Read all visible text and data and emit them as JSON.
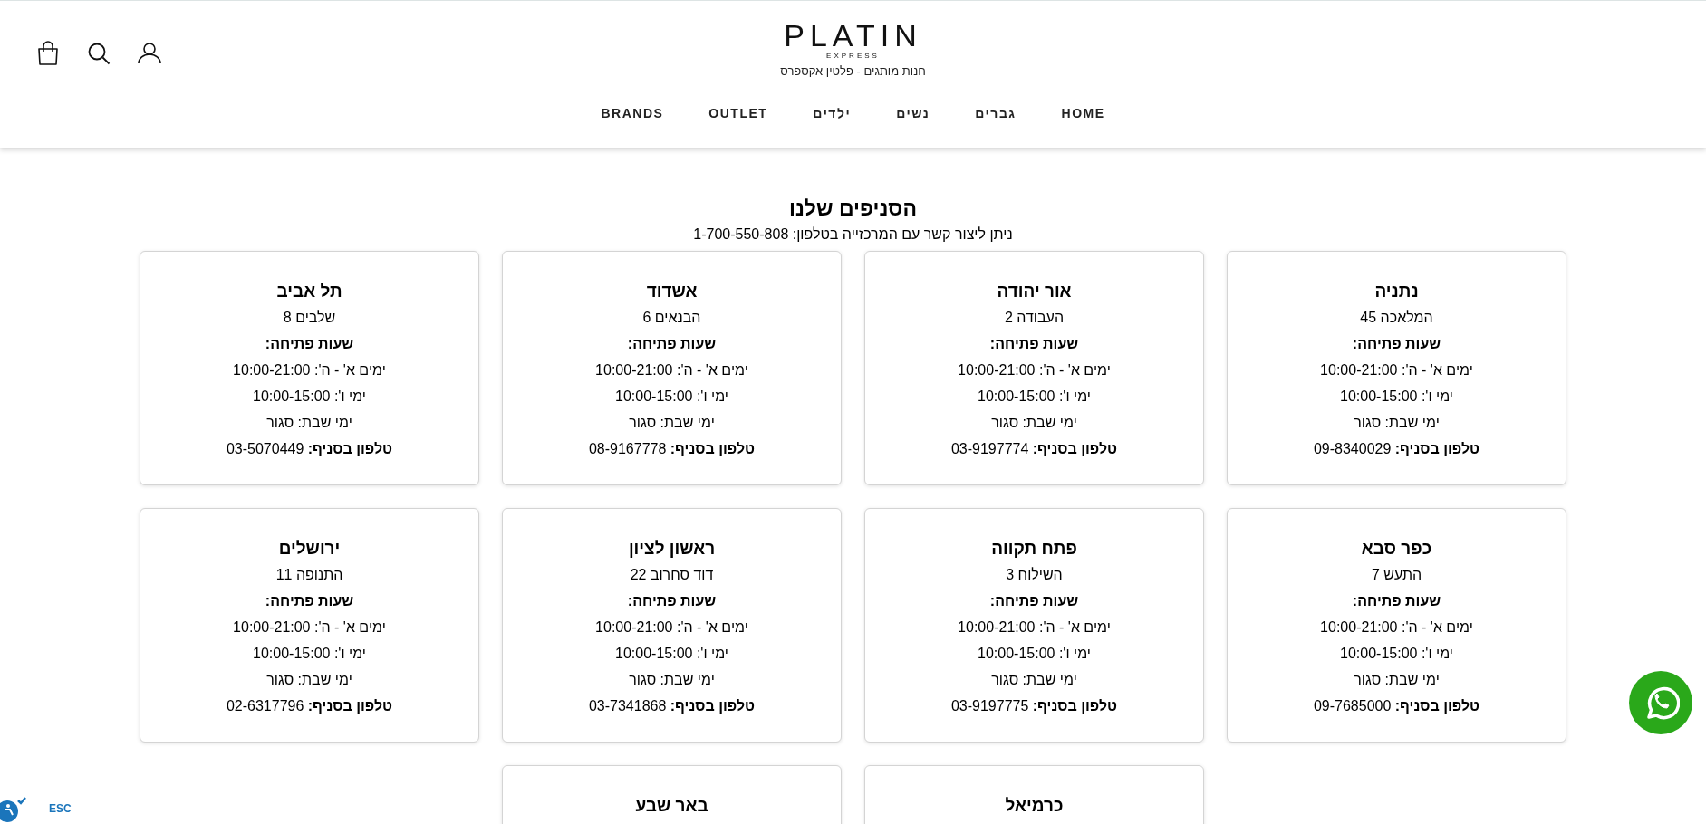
{
  "header": {
    "logo": "PLATIN",
    "logo_sub": "EXPRESS",
    "tagline": "חנות מותגים - פלטין אקספרס",
    "nav": [
      {
        "label": "HOME"
      },
      {
        "label": "גברים"
      },
      {
        "label": "נשים"
      },
      {
        "label": "ילדים"
      },
      {
        "label": "OUTLET"
      },
      {
        "label": "BRANDS"
      }
    ]
  },
  "page": {
    "title": "הסניפים שלנו",
    "subtitle": "ניתן ליצור קשר עם המרכזייה בטלפון: 1-700-550-808"
  },
  "branches": [
    {
      "name": "נתניה",
      "address": "המלאכה 45",
      "hours_title": "שעות פתיחה:",
      "lines": [
        "ימים א' - ה': 10:00-21:00",
        "ימי ו': 10:00-15:00",
        "ימי שבת: סגור"
      ],
      "phone": "**טלפון בסניף:** 09-8340029"
    },
    {
      "name": "אור יהודה",
      "address": "העבודה 2",
      "hours_title": "שעות פתיחה:",
      "lines": [
        "ימים א' - ה': 10:00-21:00",
        "ימי ו': 10:00-15:00",
        "ימי שבת: סגור"
      ],
      "phone": "**טלפון בסניף:** 03-9197774"
    },
    {
      "name": "אשדוד",
      "address": "הבנאים 6",
      "hours_title": "שעות פתיחה:",
      "lines": [
        "ימים א' - ה': 10:00-21:00",
        "ימי ו': 10:00-15:00",
        "ימי שבת: סגור"
      ],
      "phone": "**טלפון בסניף:** 08-9167778"
    },
    {
      "name": "תל אביב",
      "address": "שלבים 8",
      "hours_title": "שעות פתיחה:",
      "lines": [
        "ימים א' - ה': 10:00-21:00",
        "ימי ו': 10:00-15:00",
        "ימי שבת: סגור"
      ],
      "phone": "**טלפון בסניף:** 03-5070449"
    },
    {
      "name": "כפר סבא",
      "address": "התעש 7",
      "hours_title": "שעות פתיחה:",
      "lines": [
        "ימים א' - ה': 10:00-21:00",
        "ימי ו': 10:00-15:00",
        "ימי שבת: סגור"
      ],
      "phone": "**טלפון בסניף:** 09-7685000"
    },
    {
      "name": "פתח תקווה",
      "address": "השילוח 3",
      "hours_title": "שעות פתיחה:",
      "lines": [
        "ימים א' - ה': 10:00-21:00",
        "ימי ו': 10:00-15:00",
        "ימי שבת: סגור"
      ],
      "phone": "**טלפון בסניף:** 03-9197775"
    },
    {
      "name": "ראשון לציון",
      "address": "דוד סחרוב 22",
      "hours_title": "שעות פתיחה:",
      "lines": [
        "ימים א' - ה': 10:00-21:00",
        "ימי ו': 10:00-15:00",
        "ימי שבת: סגור"
      ],
      "phone": "**טלפון בסניף:** 03-7341868"
    },
    {
      "name": "ירושלים",
      "address": "התנופה 11",
      "hours_title": "שעות פתיחה:",
      "lines": [
        "ימים א' - ה': 10:00-21:00",
        "ימי ו': 10:00-15:00",
        "ימי שבת: סגור"
      ],
      "phone": "**טלפון בסניף:** 02-6317796"
    },
    {
      "name": "כרמיאל"
    },
    {
      "name": "באר שבע"
    }
  ],
  "accessibility": {
    "label": "ESC"
  }
}
